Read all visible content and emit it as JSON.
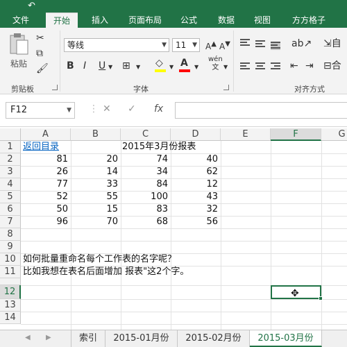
{
  "quick_access": {
    "undo_icon": "undo-icon"
  },
  "tabs": [
    "文件",
    "开始",
    "插入",
    "页面布局",
    "公式",
    "数据",
    "视图",
    "方方格子"
  ],
  "ribbon": {
    "clipboard": {
      "paste_label": "粘贴",
      "group_label": "剪贴板"
    },
    "font": {
      "name": "等线",
      "size": "11",
      "group_label": "字体",
      "phonetic_label": "wén",
      "bold": "B",
      "italic": "I",
      "underline": "U"
    },
    "alignment": {
      "group_label": "对齐方式",
      "wrap_label": "自",
      "merge_label": "合"
    }
  },
  "formula_bar": {
    "name_box": "F12",
    "cancel": "✕",
    "enter": "✓",
    "fx": "fx",
    "content": ""
  },
  "columns": [
    "A",
    "B",
    "C",
    "D",
    "E",
    "F",
    "G"
  ],
  "rows": [
    "1",
    "2",
    "3",
    "4",
    "5",
    "6",
    "7",
    "8",
    "9",
    "10",
    "11",
    "12",
    "13",
    "14"
  ],
  "cells": {
    "a1": "返回目录",
    "c1": "2015年3月份报表",
    "data": [
      [
        "81",
        "20",
        "74",
        "40"
      ],
      [
        "26",
        "14",
        "34",
        "62"
      ],
      [
        "77",
        "33",
        "84",
        "12"
      ],
      [
        "52",
        "55",
        "100",
        "43"
      ],
      [
        "50",
        "15",
        "83",
        "32"
      ],
      [
        "96",
        "70",
        "68",
        "56"
      ]
    ],
    "a10": "如何批量重命名每个工作表的名字呢？",
    "a11": "比如我想在表名后面增加 报表\"这2个字。"
  },
  "selected_cell": "F12",
  "sheet_tabs": [
    "索引",
    "2015-01月份",
    "2015-02月份",
    "2015-03月份"
  ],
  "active_sheet": "2015-03月份",
  "colors": {
    "accent": "#217346",
    "link": "#0563c1",
    "highlight": "#ffff00",
    "font_color": "#ff0000"
  }
}
